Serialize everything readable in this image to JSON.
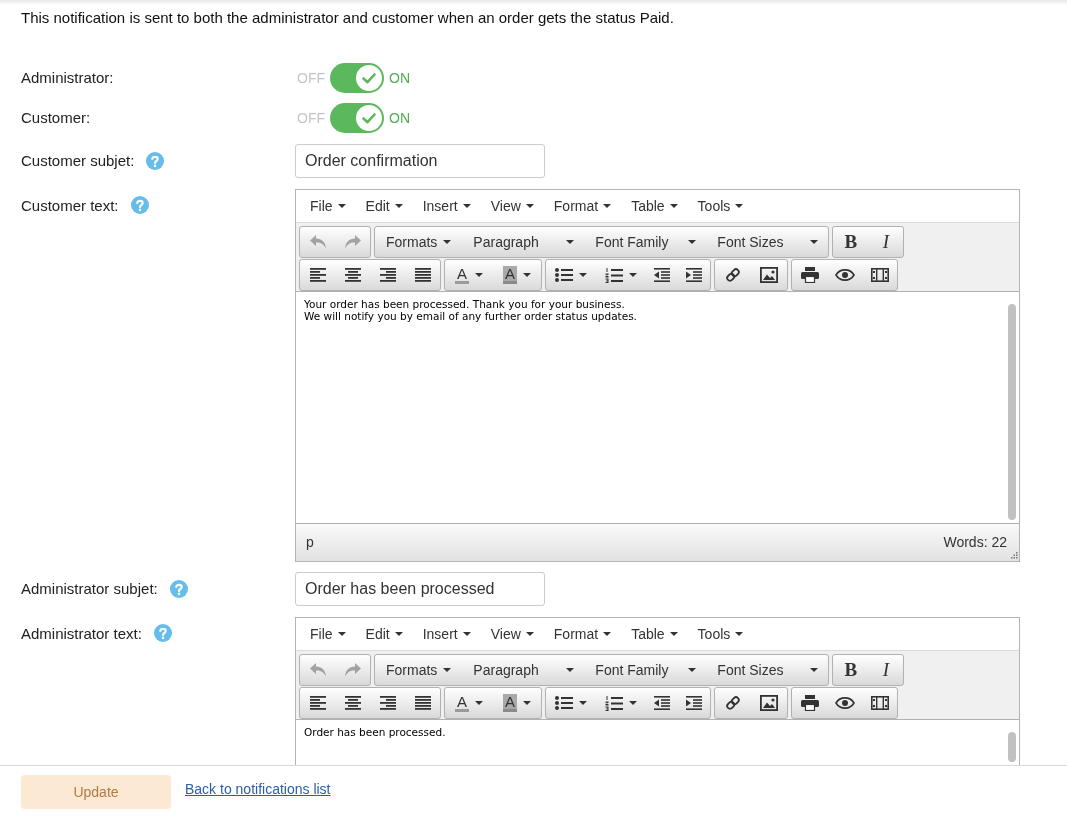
{
  "intro": "This notification is sent to both the administrator and customer when an order gets the status Paid.",
  "toggles": [
    {
      "label": "Administrator:",
      "off_label": "OFF",
      "on_label": "ON",
      "on": true
    },
    {
      "label": "Customer:",
      "off_label": "OFF",
      "on_label": "ON",
      "on": true
    }
  ],
  "sections": [
    {
      "subject_label": "Customer subjet:",
      "subject_value": "Order confirmation",
      "text_label": "Customer text:",
      "editor": {
        "menubar": [
          "File",
          "Edit",
          "Insert",
          "View",
          "Format",
          "Table",
          "Tools"
        ],
        "undo": {
          "disabled": true
        },
        "redo": {
          "disabled": true
        },
        "dropdowns": [
          {
            "kind": "menu",
            "label": "Formats"
          },
          {
            "kind": "listbox",
            "label": "Paragraph"
          },
          {
            "kind": "listbox",
            "label": "Font Family"
          },
          {
            "kind": "listbox",
            "label": "Font Sizes"
          }
        ],
        "bold": "B",
        "italic": "I",
        "text_color": "A",
        "background_color": "A",
        "content": [
          "Your order has been processed. Thank you for your business.",
          "We will notify you by email of any further order status updates."
        ],
        "status_path": "p",
        "word_count": "Words: 22"
      }
    },
    {
      "subject_label": "Administrator subjet:",
      "subject_value": "Order has been processed",
      "text_label": "Administrator text:",
      "editor": {
        "menubar": [
          "File",
          "Edit",
          "Insert",
          "View",
          "Format",
          "Table",
          "Tools"
        ],
        "undo": {
          "disabled": true
        },
        "redo": {
          "disabled": true
        },
        "dropdowns": [
          {
            "kind": "menu",
            "label": "Formats"
          },
          {
            "kind": "listbox",
            "label": "Paragraph"
          },
          {
            "kind": "listbox",
            "label": "Font Family"
          },
          {
            "kind": "listbox",
            "label": "Font Sizes"
          }
        ],
        "bold": "B",
        "italic": "I",
        "text_color": "A",
        "background_color": "A",
        "content": [
          "Order has been processed."
        ]
      }
    }
  ],
  "footer": {
    "update_button": {
      "label": "Update",
      "disabled": true
    },
    "back_link": "Back to notifications list"
  }
}
